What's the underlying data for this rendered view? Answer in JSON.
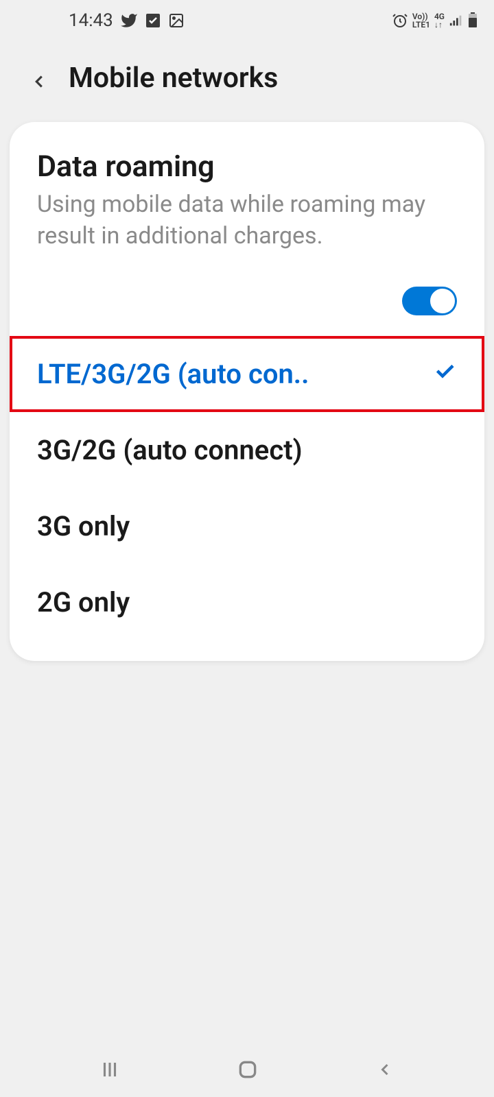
{
  "status_bar": {
    "time": "14:43",
    "network_label1": "Vo))",
    "network_label2": "LTE1",
    "network_label3": "4G"
  },
  "header": {
    "title": "Mobile networks"
  },
  "roaming": {
    "title": "Data roaming",
    "description": "Using mobile data while roaming may result in additional charges.",
    "enabled": true
  },
  "network_options": [
    {
      "label": "LTE/3G/2G (auto con..",
      "selected": true
    },
    {
      "label": "3G/2G (auto connect)",
      "selected": false
    },
    {
      "label": "3G only",
      "selected": false
    },
    {
      "label": "2G only",
      "selected": false
    }
  ]
}
